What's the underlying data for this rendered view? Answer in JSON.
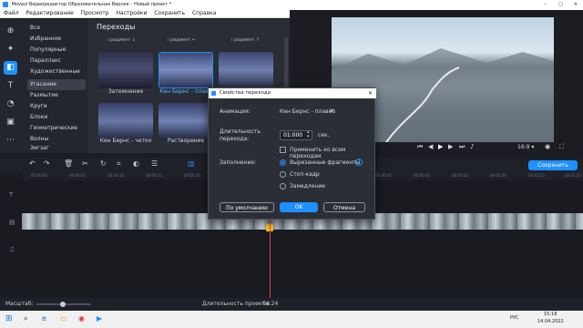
{
  "window": {
    "title": "Movavi Видеоредактор Образовательная Версия – Новый проект *"
  },
  "menu": [
    "Файл",
    "Редактирование",
    "Просмотр",
    "Настройки",
    "Сохранить",
    "Справка"
  ],
  "categories": {
    "items": [
      "Все",
      "Избранное",
      "Популярные",
      "Параллакс",
      "Художественные",
      "Угасание",
      "Размытие",
      "Круги",
      "Блоки",
      "Геометрические",
      "Волны",
      "Зигзаг"
    ],
    "active_index": 5
  },
  "transitions": {
    "title": "Переходы",
    "top_labels": [
      "ı радиент ↓",
      "ı радиент ←",
      "ı радиент ↑"
    ],
    "thumbs": [
      {
        "label": "Затемнение"
      },
      {
        "label": "Кен Бернс - плавн"
      },
      {
        "label": ""
      },
      {
        "label": "Кен Бернс - четко"
      },
      {
        "label": "Растворение"
      },
      {
        "label": ""
      }
    ]
  },
  "dialog": {
    "title": "Свойства перехода",
    "animation_label": "Анимация:",
    "animation_value": "Кен Бернс - плавно",
    "duration_label": "Длительность перехода:",
    "duration_value": "01:000",
    "duration_unit": "сек.",
    "apply_all_label": "Применить ко всем переходам",
    "fill_label": "Заполнение:",
    "fill_options": [
      "Вырезанные фрагменты",
      "Стоп-кадр",
      "Замедление"
    ],
    "fill_selected_index": 0,
    "btn_default": "По умолчанию",
    "btn_ok": "OK",
    "btn_cancel": "Отмена"
  },
  "preview": {
    "aspect": "16:9 ▾"
  },
  "export_button": "Сохранить",
  "ruler_marks": [
    "00:00:00",
    "00:00:05",
    "00:00:10",
    "00:00:15",
    "00:00:20",
    "00:00:25",
    "00:00:30",
    "00:00:35",
    "00:00:40",
    "00:00:45",
    "00:00:50",
    "00:00:55",
    "00:01:00",
    "00:01:05",
    "00:01:10"
  ],
  "footer": {
    "scale_label": "Масштаб:",
    "duration_label": "Длительность проекта:",
    "duration_value": "04:24"
  },
  "taskbar": {
    "lang": "РУС",
    "time": "15:18",
    "date": "14.04.2022"
  },
  "colors": {
    "accent": "#1e90ff",
    "dialog_bg": "#2b2e36",
    "panel_bg": "#23262e",
    "playhead": "#e8403f"
  }
}
